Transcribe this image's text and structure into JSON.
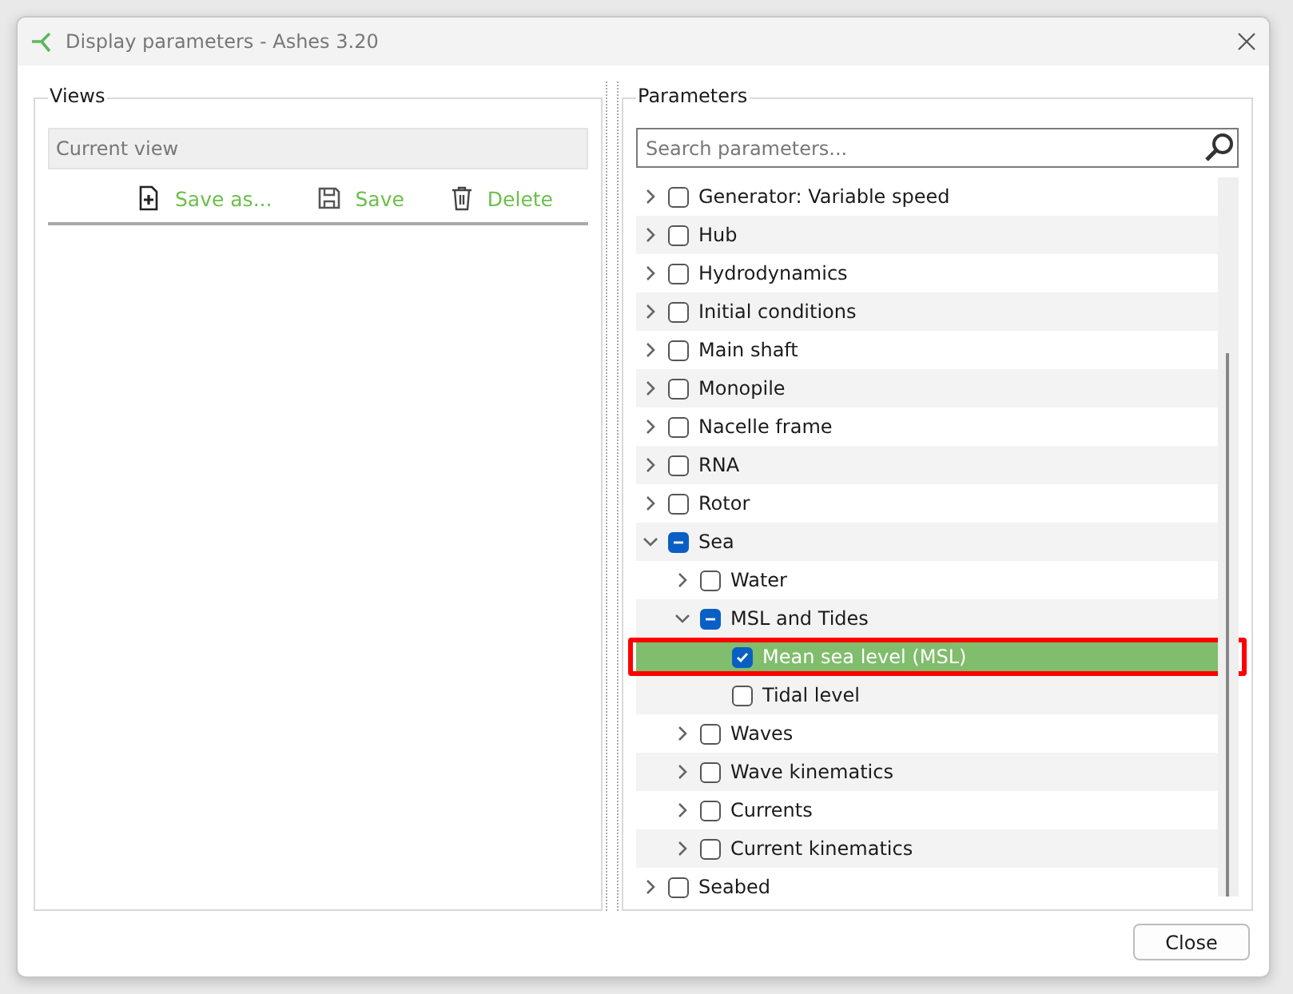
{
  "window": {
    "title": "Display parameters - Ashes 3.20"
  },
  "views": {
    "title": "Views",
    "current_view": {
      "placeholder": "Current view"
    },
    "actions": [
      {
        "kind": "save_as",
        "label": "Save as..."
      },
      {
        "kind": "save",
        "label": "Save"
      },
      {
        "kind": "delete",
        "label": "Delete"
      }
    ]
  },
  "parameters": {
    "title": "Parameters",
    "search": {
      "placeholder": "Search parameters..."
    },
    "tree": [
      {
        "label": "Generator: Variable speed",
        "expanded": false,
        "checked": false,
        "partial": false,
        "selected": false
      },
      {
        "label": "Hub",
        "expanded": false,
        "checked": false,
        "partial": false,
        "selected": false
      },
      {
        "label": "Hydrodynamics",
        "expanded": false,
        "checked": false,
        "partial": false,
        "selected": false
      },
      {
        "label": "Initial conditions",
        "expanded": false,
        "checked": false,
        "partial": false,
        "selected": false
      },
      {
        "label": "Main shaft",
        "expanded": false,
        "checked": false,
        "partial": false,
        "selected": false
      },
      {
        "label": "Monopile",
        "expanded": false,
        "checked": false,
        "partial": false,
        "selected": false
      },
      {
        "label": "Nacelle frame",
        "expanded": false,
        "checked": false,
        "partial": false,
        "selected": false
      },
      {
        "label": "RNA",
        "expanded": false,
        "checked": false,
        "partial": false,
        "selected": false
      },
      {
        "label": "Rotor",
        "expanded": false,
        "checked": false,
        "partial": false,
        "selected": false
      },
      {
        "label": "Sea",
        "expanded": true,
        "checked": false,
        "partial": true,
        "selected": false,
        "children": [
          {
            "label": "Water",
            "expanded": false,
            "checked": false,
            "partial": false,
            "selected": false
          },
          {
            "label": "MSL and Tides",
            "expanded": true,
            "checked": false,
            "partial": true,
            "selected": false,
            "children": [
              {
                "label": "Mean sea level (MSL)",
                "checked": true,
                "partial": false,
                "selected": true,
                "highlighted": true
              },
              {
                "label": "Tidal level",
                "checked": false,
                "partial": false,
                "selected": false,
                "highlighted": false
              }
            ]
          },
          {
            "label": "Waves",
            "expanded": false,
            "checked": false,
            "partial": false,
            "selected": false
          },
          {
            "label": "Wave kinematics",
            "expanded": false,
            "checked": false,
            "partial": false,
            "selected": false
          },
          {
            "label": "Currents",
            "expanded": false,
            "checked": false,
            "partial": false,
            "selected": false
          },
          {
            "label": "Current kinematics",
            "expanded": false,
            "checked": false,
            "partial": false,
            "selected": false
          }
        ]
      },
      {
        "label": "Seabed",
        "expanded": false,
        "checked": false,
        "partial": false,
        "selected": false
      }
    ]
  },
  "buttons": [
    {
      "label": "Close"
    }
  ]
}
